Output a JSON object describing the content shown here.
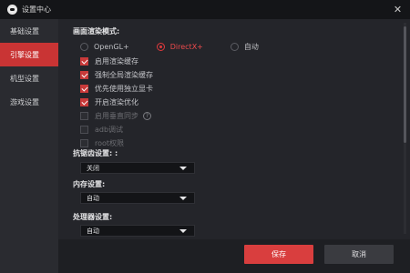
{
  "window": {
    "title": "设置中心",
    "close_icon": "close-icon"
  },
  "sidebar": {
    "items": [
      {
        "label": "基础设置",
        "active": false
      },
      {
        "label": "引擎设置",
        "active": true
      },
      {
        "label": "机型设置",
        "active": false
      },
      {
        "label": "游戏设置",
        "active": false
      }
    ]
  },
  "render": {
    "title": "画面渲染模式:",
    "options": [
      {
        "label": "OpenGL+",
        "selected": false
      },
      {
        "label": "DirectX+",
        "selected": true
      },
      {
        "label": "自动",
        "selected": false
      }
    ]
  },
  "checkboxes": [
    {
      "label": "启用渲染缓存",
      "checked": true,
      "disabled": false
    },
    {
      "label": "强制全局渲染缓存",
      "checked": true,
      "disabled": false
    },
    {
      "label": "优先使用独立显卡",
      "checked": true,
      "disabled": false
    },
    {
      "label": "开启渲染优化",
      "checked": true,
      "disabled": false
    },
    {
      "label": "启用垂直同步",
      "checked": false,
      "disabled": true,
      "help": "?"
    },
    {
      "label": "adb调试",
      "checked": false,
      "disabled": true
    },
    {
      "label": "root权限",
      "checked": false,
      "disabled": true
    }
  ],
  "antialias": {
    "title": "抗锯齿设置: :",
    "value": "关闭"
  },
  "memory": {
    "title": "内存设置:",
    "value": "自动"
  },
  "cpu": {
    "title": "处理器设置:",
    "value": "自动"
  },
  "footer": {
    "save_label": "保存",
    "cancel_label": "取消"
  },
  "colors": {
    "accent": "#d93e3e",
    "sidebar_bg": "#2a2b30",
    "content_bg": "#24252a"
  }
}
